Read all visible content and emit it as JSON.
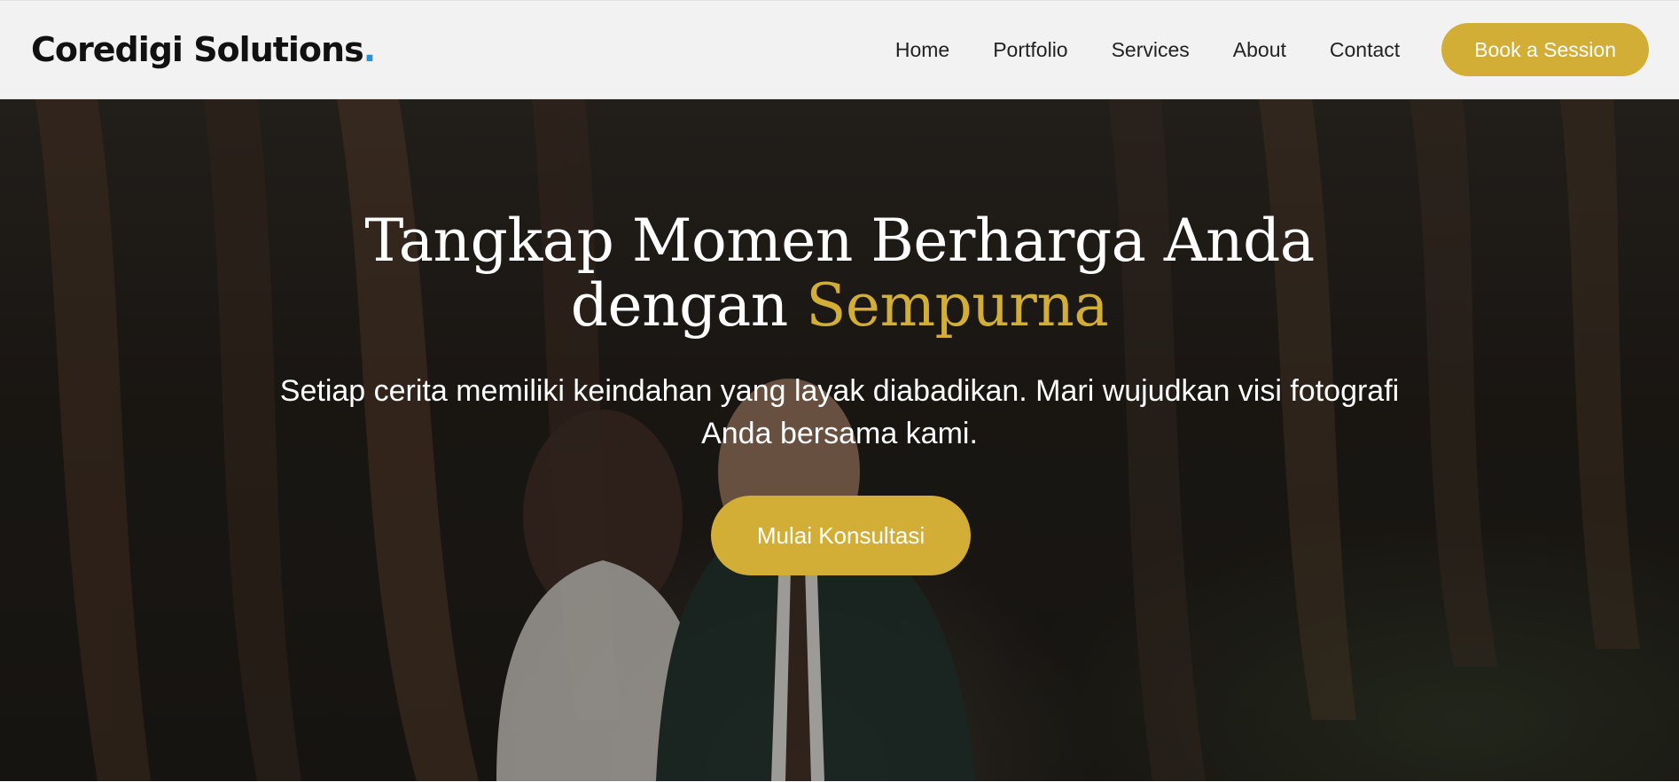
{
  "header": {
    "brand": "Coredigi Solutions",
    "brand_dot": ".",
    "nav": [
      {
        "label": "Home"
      },
      {
        "label": "Portfolio"
      },
      {
        "label": "Services"
      },
      {
        "label": "About"
      },
      {
        "label": "Contact"
      }
    ],
    "cta_label": "Book a Session"
  },
  "hero": {
    "title_line1": "Tangkap Momen Berharga Anda",
    "title_line2_prefix": "dengan ",
    "title_highlight": "Sempurna",
    "subtitle": "Setiap cerita memiliki keindahan yang layak diabadikan. Mari wujudkan visi fotografi Anda bersama kami.",
    "cta_label": "Mulai Konsultasi"
  },
  "colors": {
    "accent": "#d2ae37",
    "brand_dot": "#2e8fd6",
    "navbar_bg": "#f2f2f2",
    "text_dark": "#222222"
  }
}
